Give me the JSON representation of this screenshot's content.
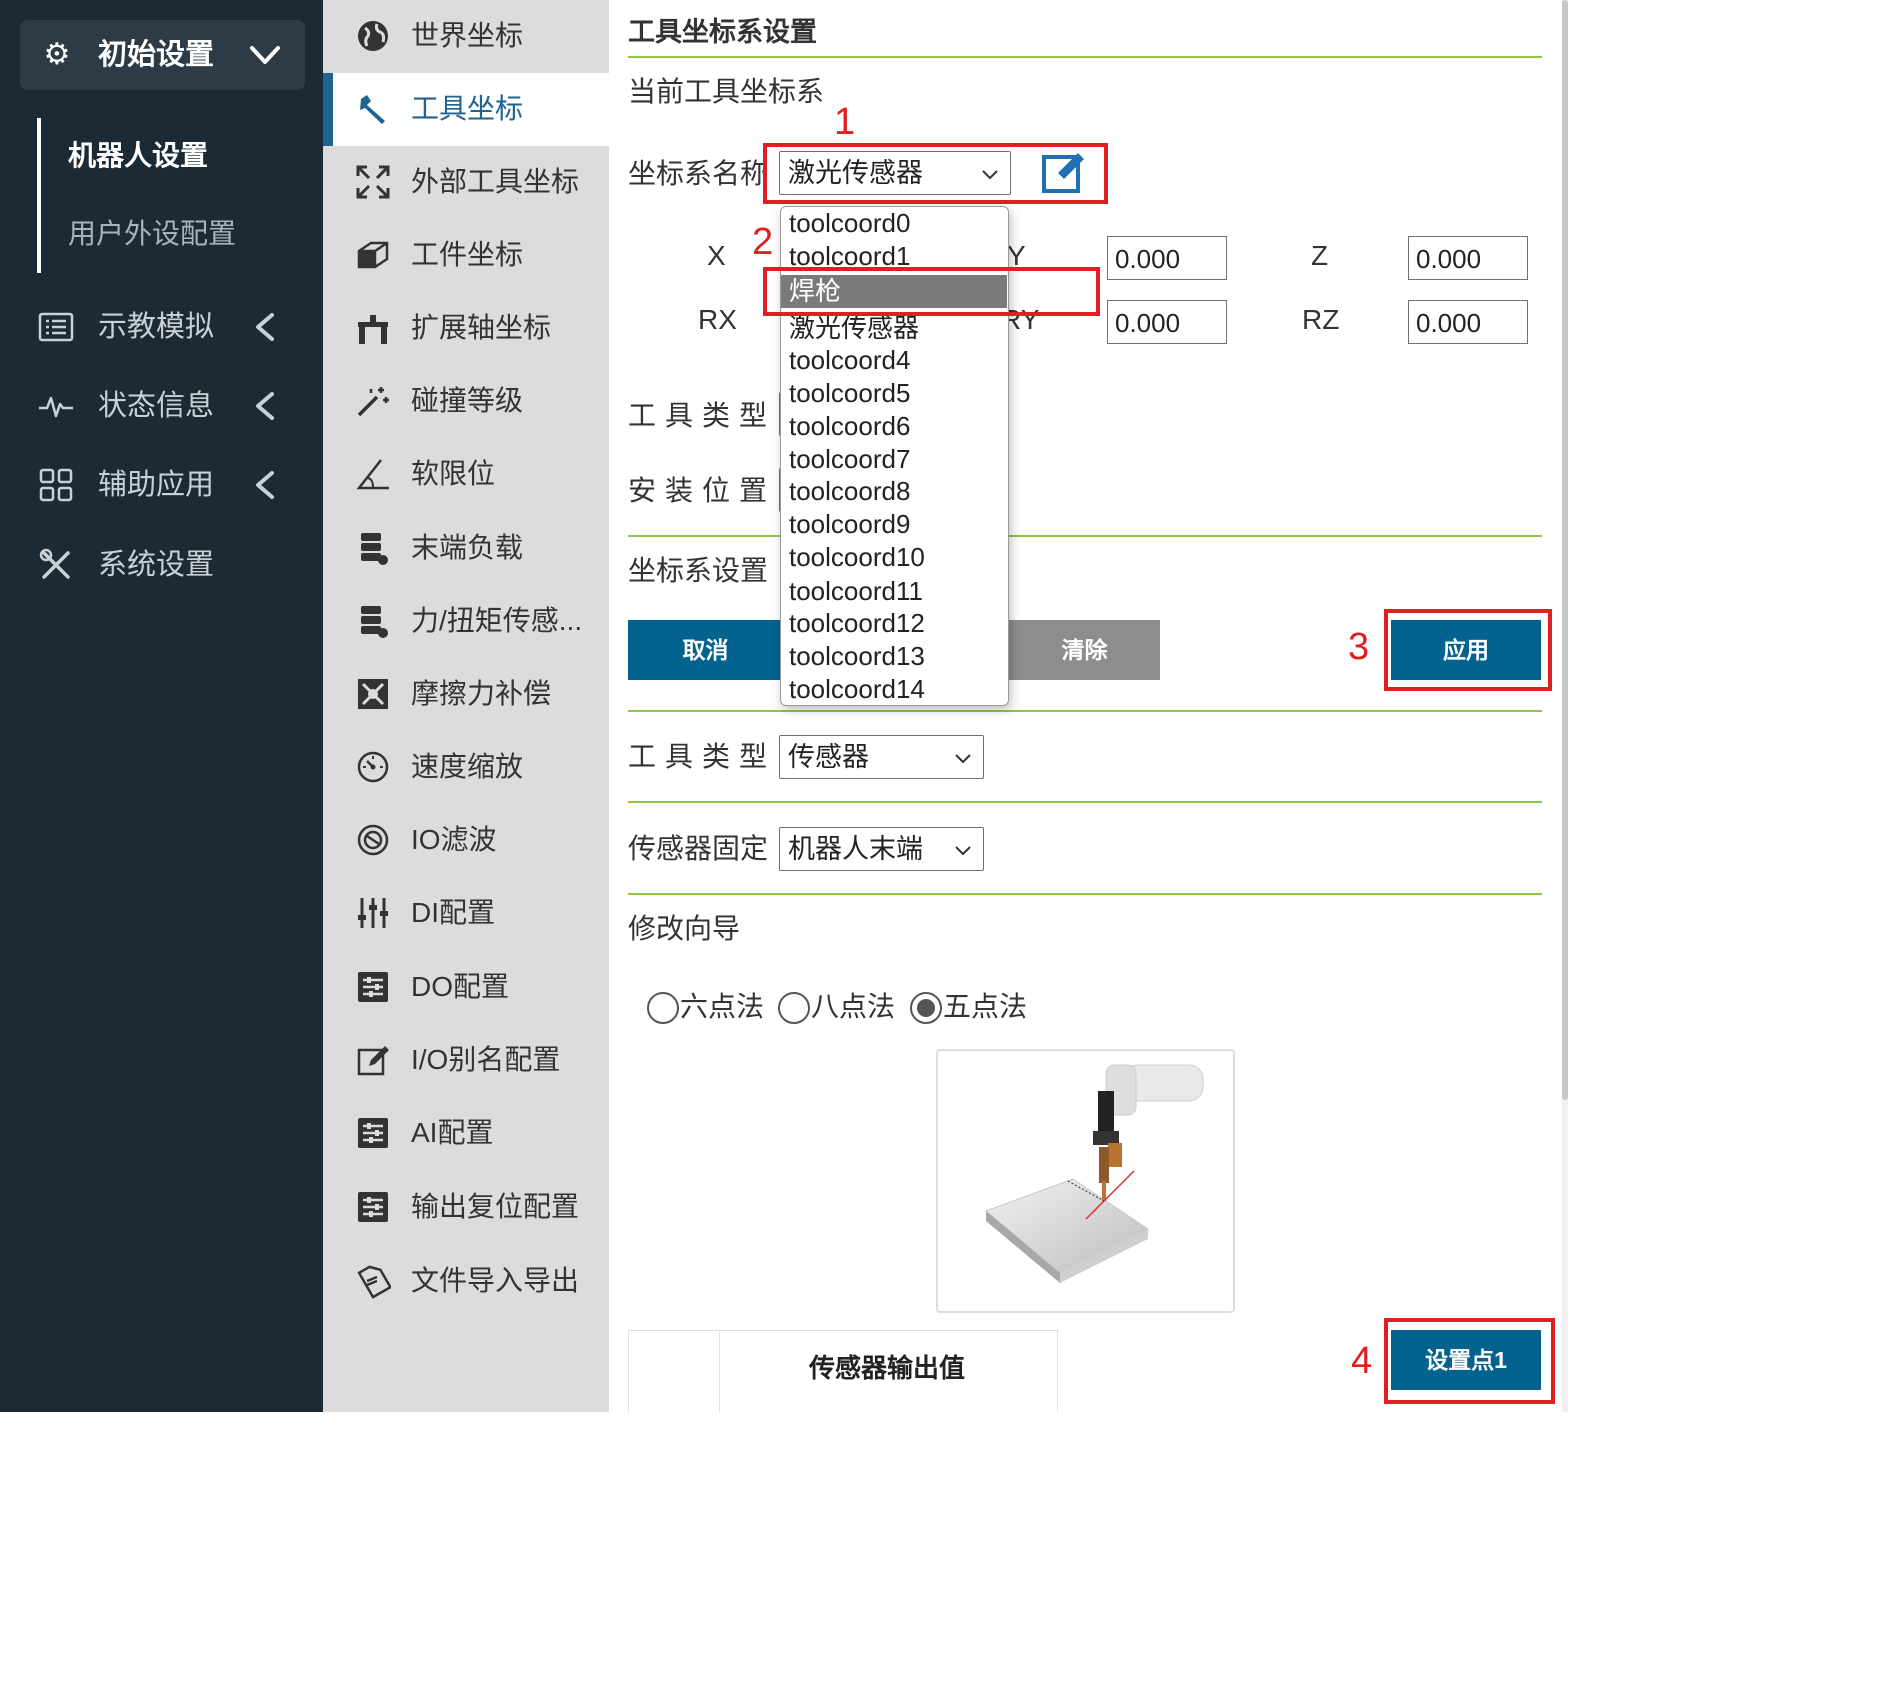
{
  "sidebar": {
    "header": {
      "icon": "gear-icon",
      "label": "初始设置",
      "chevron": "chevron-down-icon"
    },
    "sub_items": [
      "机器人设置",
      "用户外设配置"
    ],
    "items": [
      {
        "icon": "list-icon",
        "label": "示教模拟",
        "arrow": "chevron-left-icon"
      },
      {
        "icon": "pulse-icon",
        "label": "状态信息",
        "arrow": "chevron-left-icon"
      },
      {
        "icon": "grid-icon",
        "label": "辅助应用",
        "arrow": "chevron-left-icon"
      },
      {
        "icon": "tools-icon",
        "label": "系统设置",
        "arrow": ""
      }
    ]
  },
  "menu": {
    "items": [
      {
        "icon": "globe-icon",
        "label": "世界坐标"
      },
      {
        "icon": "wrench-icon",
        "label": "工具坐标",
        "active": true
      },
      {
        "icon": "expand-icon",
        "label": "外部工具坐标"
      },
      {
        "icon": "cube-icon",
        "label": "工件坐标"
      },
      {
        "icon": "extension-axis-icon",
        "label": "扩展轴坐标"
      },
      {
        "icon": "magic-wand-icon",
        "label": "碰撞等级"
      },
      {
        "icon": "angle-icon",
        "label": "软限位"
      },
      {
        "icon": "load-icon",
        "label": "末端负载"
      },
      {
        "icon": "sensor-icon",
        "label": "力/扭矩传感..."
      },
      {
        "icon": "friction-icon",
        "label": "摩擦力补偿"
      },
      {
        "icon": "speed-icon",
        "label": "速度缩放"
      },
      {
        "icon": "filter-icon",
        "label": "IO滤波"
      },
      {
        "icon": "sliders-icon",
        "label": "DI配置"
      },
      {
        "icon": "config-icon",
        "label": "DO配置"
      },
      {
        "icon": "edit-icon",
        "label": "I/O别名配置"
      },
      {
        "icon": "config-icon",
        "label": "AI配置"
      },
      {
        "icon": "config-icon",
        "label": "输出复位配置"
      },
      {
        "icon": "file-transfer-icon",
        "label": "文件导入导出"
      }
    ]
  },
  "main": {
    "title": "工具坐标系设置",
    "current_label": "当前工具坐标系",
    "coord_name_label": "坐标系名称",
    "coord_name_value": "激光传感器",
    "x_label": "X",
    "y_label": "Y",
    "z_label": "Z",
    "rx_label": "RX",
    "ry_label": "RY",
    "rz_label": "RZ",
    "y_value": "0.000",
    "z_value": "0.000",
    "ry_value": "0.000",
    "rz_value": "0.000",
    "tool_type_label": "工具类型",
    "install_pos_label": "安装位置",
    "coord_setting_label": "坐标系设置",
    "cancel_label": "取消",
    "clear_label": "清除",
    "apply_label": "应用",
    "tool_type2_label": "工具类型",
    "tool_type2_value": "传感器",
    "sensor_fixed_label": "传感器固定",
    "sensor_fixed_value": "机器人末端",
    "wizard_label": "修改向导",
    "methods": [
      "六点法",
      "八点法",
      "五点法"
    ],
    "selected_method": "五点法",
    "table_header": "传感器输出值",
    "setpoint_label": "设置点1"
  },
  "dropdown": {
    "options": [
      "toolcoord0",
      "toolcoord1",
      "焊枪",
      "激光传感器",
      "toolcoord4",
      "toolcoord5",
      "toolcoord6",
      "toolcoord7",
      "toolcoord8",
      "toolcoord9",
      "toolcoord10",
      "toolcoord11",
      "toolcoord12",
      "toolcoord13",
      "toolcoord14"
    ],
    "highlighted": "焊枪"
  },
  "annotations": [
    "1",
    "2",
    "3",
    "4"
  ],
  "colors": {
    "sidebar": "#1b2a35",
    "accent": "#1f6391",
    "button": "#04628f",
    "divider": "#8dc63f",
    "annotation": "#e02020"
  }
}
